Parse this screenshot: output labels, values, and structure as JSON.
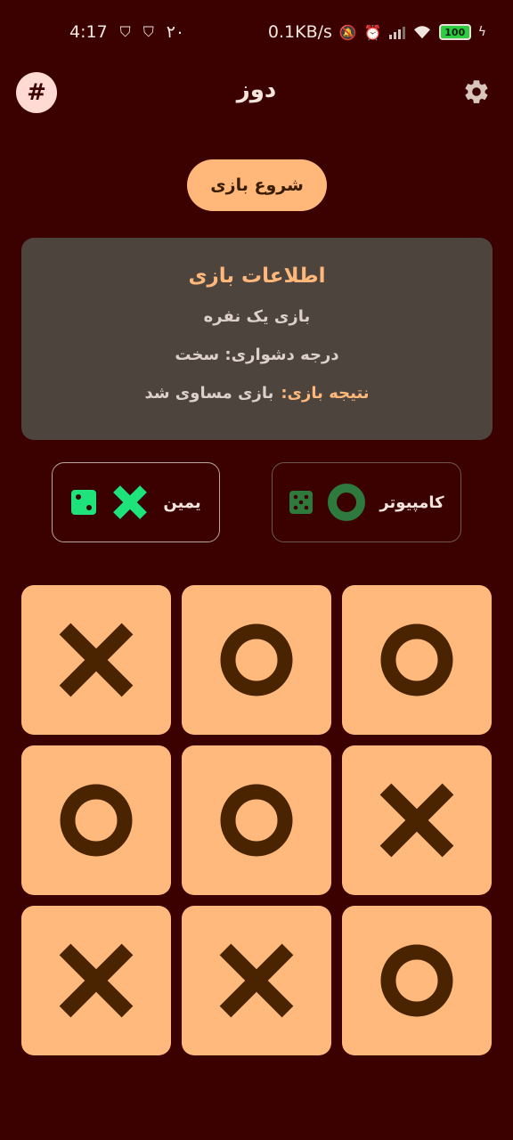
{
  "status_bar": {
    "time": "4:17",
    "extra_digits": "۲۰",
    "net_speed": "0.1KB/s",
    "battery": "100"
  },
  "app_bar": {
    "title": "دوز",
    "left_icon": "hash-icon",
    "right_icon": "gear-icon"
  },
  "start_button": {
    "label": "شروع بازی"
  },
  "info": {
    "title": "اطلاعات بازی",
    "mode": "بازی یک نفره",
    "difficulty": "درجه دشواری: سخت",
    "result_label": "نتیجه بازی:",
    "result_value": "بازی مساوی شد"
  },
  "players": {
    "you": {
      "name": "یمین",
      "mark": "X",
      "mark_color": "#1ee37a",
      "dice_color": "#1ee37a"
    },
    "computer": {
      "name": "کامپیوتر",
      "mark": "O",
      "mark_color": "#2e7a3c",
      "dice_color": "#2e7a3c"
    }
  },
  "board": {
    "cells": [
      "X",
      "O",
      "O",
      "O",
      "O",
      "X",
      "X",
      "X",
      "O"
    ],
    "mark_color": "#4a2400"
  },
  "colors": {
    "background": "#3b0000",
    "accent": "#ffb77a",
    "card": "#4e443e"
  }
}
